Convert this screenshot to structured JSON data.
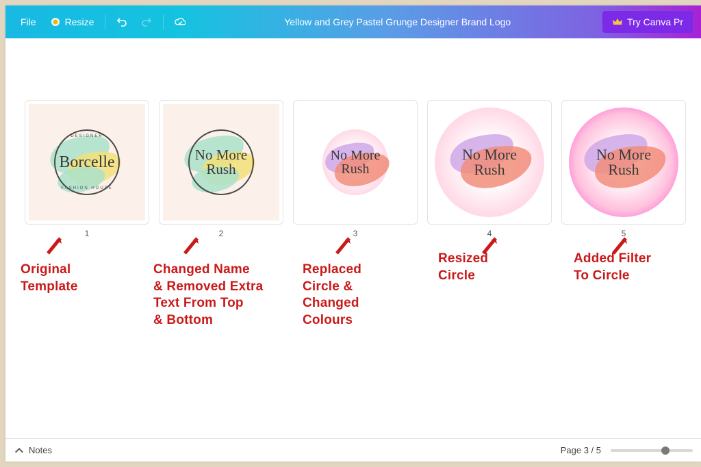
{
  "header": {
    "file": "File",
    "resize": "Resize",
    "title": "Yellow and Grey Pastel Grunge Designer Brand Logo",
    "try_pro": "Try Canva Pr"
  },
  "thumbs": [
    {
      "num": "1",
      "script_top": "Borcelle",
      "script_bottom": "",
      "top_label": "DESIGNER",
      "bottom_label": "FASHION HOUSE"
    },
    {
      "num": "2",
      "script_top": "No More",
      "script_bottom": "Rush"
    },
    {
      "num": "3",
      "script_top": "No More",
      "script_bottom": "Rush"
    },
    {
      "num": "4",
      "script_top": "No More",
      "script_bottom": "Rush"
    },
    {
      "num": "5",
      "script_top": "No More",
      "script_bottom": "Rush"
    }
  ],
  "annotations": {
    "a1": "Original\nTemplate",
    "a2": "Changed Name\n& Removed Extra\nText From Top\n& Bottom",
    "a3": "Replaced\nCircle &\nChanged\nColours",
    "a4": "Resized\nCircle",
    "a5": "Added Filter\nTo Circle"
  },
  "bottom": {
    "notes": "Notes",
    "page": "Page 3 / 5"
  }
}
